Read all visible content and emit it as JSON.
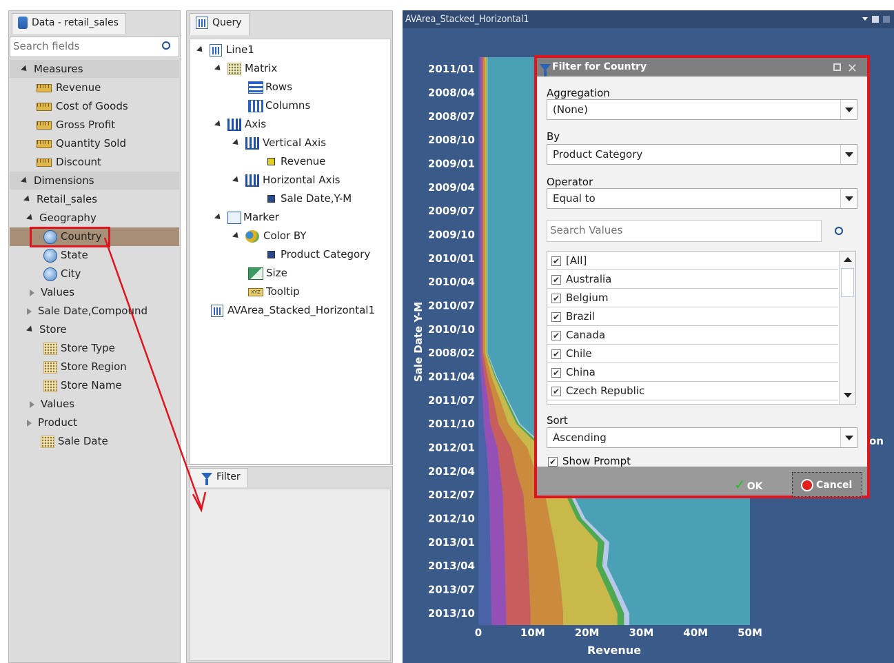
{
  "data_panel": {
    "title": "Data - retail_sales",
    "search_placeholder": "Search fields",
    "measures_label": "Measures",
    "measures": [
      "Revenue",
      "Cost of Goods",
      "Gross Profit",
      "Quantity Sold",
      "Discount"
    ],
    "dimensions_label": "Dimensions",
    "retail_sales": "Retail_sales",
    "geography": "Geography",
    "geo_items": [
      "Country",
      "State",
      "City"
    ],
    "values1": "Values",
    "sale_date_compound": "Sale Date,Compound",
    "store": "Store",
    "store_items": [
      "Store Type",
      "Store Region",
      "Store Name"
    ],
    "values2": "Values",
    "product": "Product",
    "sale_date": "Sale Date"
  },
  "query_panel": {
    "title": "Query",
    "line1": "Line1",
    "matrix": "Matrix",
    "rows": "Rows",
    "columns": "Columns",
    "axis": "Axis",
    "vertical_axis": "Vertical Axis",
    "revenue": "Revenue",
    "horizontal_axis": "Horizontal Axis",
    "sale_date_ym": "Sale Date,Y-M",
    "marker": "Marker",
    "color_by": "Color BY",
    "product_category": "Product Category",
    "size": "Size",
    "tooltip": "Tooltip",
    "chart_name": "AVArea_Stacked_Horizontal1"
  },
  "filter_panel": {
    "title": "Filter"
  },
  "chart_window": {
    "title": "AVArea_Stacked_Horizontal1",
    "behind_text_1": "on"
  },
  "colors": {
    "chart_bg": "#3a5a8a",
    "dialog_border": "#e0141e",
    "selected_row": "#a89078"
  },
  "chart_data": {
    "type": "area",
    "orientation": "horizontal",
    "stacked": true,
    "ylabel": "Sale Date Y-M",
    "xlabel": "Revenue",
    "categories": [
      "2011/01",
      "2008/04",
      "2008/07",
      "2008/10",
      "2009/01",
      "2009/04",
      "2009/07",
      "2009/10",
      "2010/01",
      "2010/04",
      "2010/07",
      "2010/10",
      "2008/02",
      "2011/04",
      "2011/07",
      "2011/10",
      "2012/01",
      "2012/04",
      "2012/07",
      "2012/10",
      "2013/01",
      "2013/04",
      "2013/07",
      "2013/10"
    ],
    "x_ticks": [
      "0",
      "10M",
      "20M",
      "30M",
      "40M",
      "50M"
    ],
    "xlim": [
      0,
      50000000
    ],
    "series_colors": [
      "#4a63a8",
      "#9550b8",
      "#c85d5d",
      "#cc8a3c",
      "#c9b84a",
      "#4ea84e",
      "#b8c8e8",
      "#4aa0b4"
    ],
    "series": [
      {
        "values": [
          0.3,
          0.3,
          0.3,
          0.3,
          0.3,
          0.3,
          0.3,
          0.3,
          0.3,
          0.3,
          0.3,
          0.3,
          0.3,
          0.5,
          0.8,
          1.0,
          1.5,
          1.8,
          2.0,
          2.1,
          2.2,
          2.3,
          2.3,
          2.4
        ]
      },
      {
        "values": [
          0.3,
          0.3,
          0.3,
          0.3,
          0.3,
          0.3,
          0.3,
          0.3,
          0.3,
          0.3,
          0.3,
          0.3,
          0.3,
          0.6,
          1.0,
          1.2,
          2.0,
          2.2,
          2.5,
          2.5,
          2.6,
          2.6,
          2.7,
          2.7
        ]
      },
      {
        "values": [
          0.3,
          0.3,
          0.3,
          0.3,
          0.3,
          0.3,
          0.3,
          0.3,
          0.3,
          0.3,
          0.3,
          0.3,
          0.3,
          0.6,
          1.0,
          1.5,
          2.5,
          3.0,
          3.8,
          4.0,
          4.2,
          4.3,
          4.4,
          4.5
        ]
      },
      {
        "values": [
          0.3,
          0.3,
          0.3,
          0.3,
          0.3,
          0.3,
          0.3,
          0.3,
          0.3,
          0.3,
          0.3,
          0.3,
          0.3,
          0.7,
          1.2,
          1.8,
          3.0,
          3.5,
          4.0,
          4.5,
          5.0,
          5.5,
          5.8,
          6.0
        ]
      },
      {
        "values": [
          0.3,
          0.3,
          0.3,
          0.3,
          0.3,
          0.3,
          0.3,
          0.3,
          0.3,
          0.3,
          0.3,
          0.3,
          0.3,
          0.6,
          1.0,
          1.5,
          2.5,
          3.0,
          3.8,
          5.0,
          8.0,
          7.0,
          8.5,
          10.0
        ]
      },
      {
        "values": [
          0.1,
          0.1,
          0.1,
          0.1,
          0.1,
          0.1,
          0.1,
          0.1,
          0.1,
          0.1,
          0.1,
          0.1,
          0.1,
          0.2,
          0.3,
          0.4,
          0.6,
          0.7,
          0.8,
          0.9,
          1.2,
          1.1,
          1.2,
          1.2
        ]
      },
      {
        "values": [
          0.1,
          0.1,
          0.1,
          0.1,
          0.1,
          0.1,
          0.1,
          0.1,
          0.1,
          0.1,
          0.1,
          0.1,
          0.1,
          0.2,
          0.2,
          0.3,
          0.4,
          0.5,
          0.6,
          0.7,
          0.9,
          0.9,
          0.9,
          1.0
        ]
      },
      {
        "values": [
          1.0,
          1.0,
          1.0,
          1.0,
          1.0,
          1.0,
          1.0,
          1.0,
          1.0,
          1.0,
          1.0,
          1.0,
          1.0,
          1.0,
          1.0,
          1.0,
          1.0,
          1.0,
          1.0,
          1.0,
          1.0,
          1.0,
          1.0,
          1.0
        ]
      }
    ]
  },
  "dialog": {
    "title": "Filter for Country",
    "aggregation_label": "Aggregation",
    "aggregation_value": "(None)",
    "by_label": "By",
    "by_value": "Product Category",
    "operator_label": "Operator",
    "operator_value": "Equal to",
    "search_placeholder": "Search Values",
    "values": [
      "[All]",
      "Australia",
      "Belgium",
      "Brazil",
      "Canada",
      "Chile",
      "China",
      "Czech Republic"
    ],
    "sort_label": "Sort",
    "sort_value": "Ascending",
    "show_prompt": "Show Prompt",
    "ok": "OK",
    "cancel": "Cancel"
  }
}
